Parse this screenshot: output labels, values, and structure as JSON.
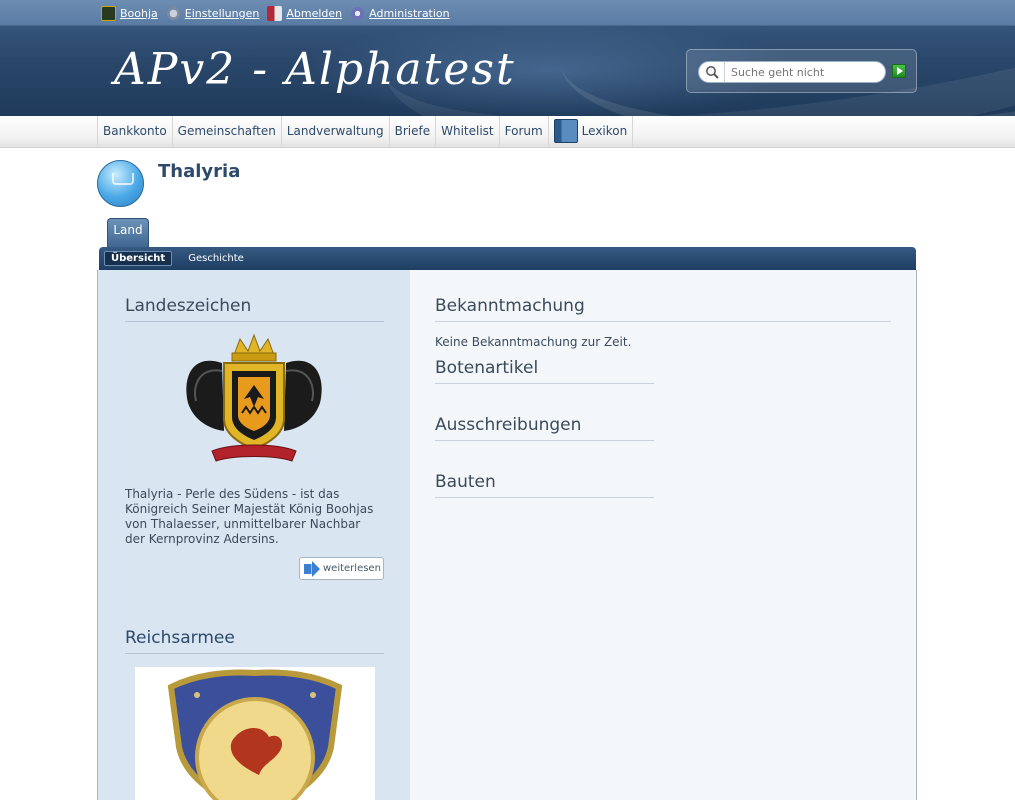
{
  "userbar": {
    "items": [
      {
        "label": "Boohja",
        "icon": "user-avatar-icon"
      },
      {
        "label": "Einstellungen",
        "icon": "settings-icon"
      },
      {
        "label": "Abmelden",
        "icon": "logout-icon"
      },
      {
        "label": "Administration",
        "icon": "admin-gear-icon"
      }
    ]
  },
  "header": {
    "logo_text": "APv2 - Alphatest",
    "search_placeholder": "Suche geht nicht",
    "search_go_icon": "green-play-icon"
  },
  "nav": {
    "items": [
      {
        "label": "Bankkonto"
      },
      {
        "label": "Gemeinschaften"
      },
      {
        "label": "Landverwaltung"
      },
      {
        "label": "Briefe"
      },
      {
        "label": "Whitelist"
      },
      {
        "label": "Forum"
      },
      {
        "label": "Lexikon",
        "icon": "book-icon"
      }
    ]
  },
  "page": {
    "title": "Thalyria",
    "tab": "Land",
    "subtabs": [
      "Übersicht",
      "Geschichte"
    ]
  },
  "sidebar": {
    "landeszeichen_title": "Landeszeichen",
    "description": "Thalyria - Perle des Südens - ist das Königreich Seiner Majestät König Boohjas von Thalaesser, unmittelbarer Nachbar der Kernprovinz Adersins.",
    "readmore_label": "weiterlesen",
    "reichsarmee_title": "Reichsarmee"
  },
  "main": {
    "bekanntmachung_title": "Bekanntmachung",
    "bekanntmachung_text": "Keine Bekanntmachung zur Zeit.",
    "botenartikel_title": "Botenartikel",
    "ausschreibungen_title": "Ausschreibungen",
    "bauten_title": "Bauten"
  },
  "colors": {
    "accent": "#2d4a6b",
    "header": "#2c4a6e",
    "sidebar_bg": "#d9e5f1"
  }
}
